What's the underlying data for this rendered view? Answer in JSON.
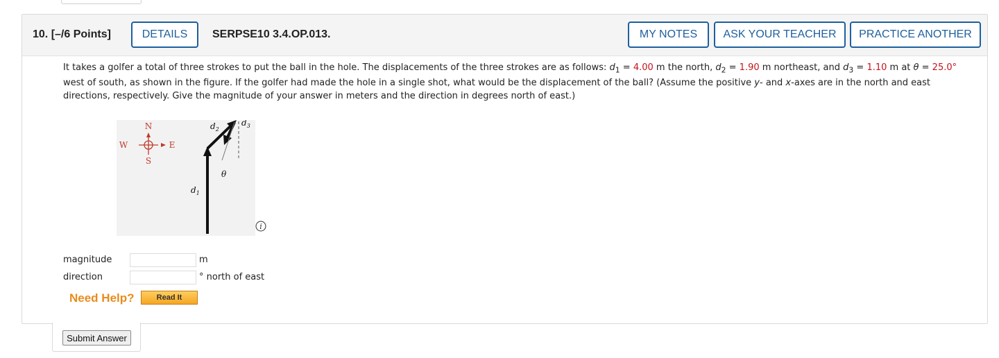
{
  "question": {
    "number_points": "10.  [–/6 Points]",
    "code": "SERPSE10 3.4.OP.013."
  },
  "header_buttons": {
    "details": "DETAILS",
    "my_notes": "MY NOTES",
    "ask_teacher": "ASK YOUR TEACHER",
    "practice_another": "PRACTICE ANOTHER"
  },
  "problem": {
    "p1": "It takes a golfer a total of three strokes to put the ball in the hole. The displacements of the three strokes are as follows: ",
    "d1_var": "d",
    "d1_sub": "1",
    "eq": " = ",
    "d1_val": "4.00",
    "p2": " m the north, ",
    "d2_var": "d",
    "d2_sub": "2",
    "d2_val": "1.90",
    "p3": " m northeast, and ",
    "d3_var": "d",
    "d3_sub": "3",
    "d3_val": "1.10",
    "p4": " m at ",
    "theta": "θ",
    "theta_val": "25.0°",
    "p5": " west of south, as shown in the figure. If the golfer had made the hole in a single shot, what would be the displacement of the ball? (Assume the positive ",
    "y_var": "y",
    "p6": "- and ",
    "x_var": "x",
    "p7": "-axes are in the north and east directions, respectively. Give the magnitude of your answer in meters and the direction in degrees north of east.)"
  },
  "figure": {
    "compass": {
      "n": "N",
      "s": "S",
      "e": "E",
      "w": "W"
    },
    "d1_label": "d",
    "d1_sub": "1",
    "d2_label": "d",
    "d2_sub": "2",
    "d3_label": "d",
    "d3_sub": "3",
    "theta_label": "θ",
    "info_icon_glyph": "i"
  },
  "answers": {
    "magnitude_label": "magnitude",
    "magnitude_value": "",
    "magnitude_unit": "m",
    "direction_label": "direction",
    "direction_value": "",
    "direction_unit": "° north of east"
  },
  "help": {
    "need_help": "Need Help?",
    "read_it": "Read It"
  },
  "submit": {
    "label": "Submit Answer"
  },
  "colors": {
    "button_blue": "#1d5f9e",
    "value_red": "#c3141b",
    "need_help_orange": "#e98b1b",
    "compass_red": "#c0392b"
  }
}
